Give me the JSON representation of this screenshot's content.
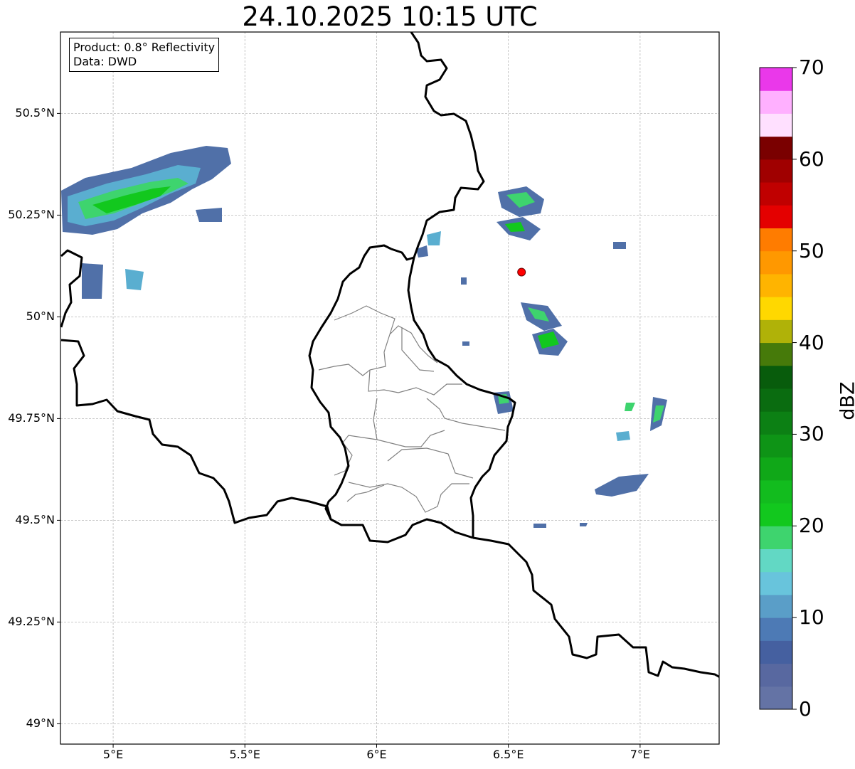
{
  "title": "24.10.2025 10:15 UTC",
  "info": {
    "product": "Product: 0.8° Reflectivity",
    "data": "Data: DWD"
  },
  "axes": {
    "lon_range": [
      4.8,
      7.3
    ],
    "lat_range": [
      48.95,
      50.7
    ],
    "x_ticks": [
      {
        "value": 5.0,
        "label": "5°E"
      },
      {
        "value": 5.5,
        "label": "5.5°E"
      },
      {
        "value": 6.0,
        "label": "6°E"
      },
      {
        "value": 6.5,
        "label": "6.5°E"
      },
      {
        "value": 7.0,
        "label": "7°E"
      }
    ],
    "y_ticks": [
      {
        "value": 50.5,
        "label": "50.5°N"
      },
      {
        "value": 50.25,
        "label": "50.25°N"
      },
      {
        "value": 50.0,
        "label": "50°N"
      },
      {
        "value": 49.75,
        "label": "49.75°N"
      },
      {
        "value": 49.5,
        "label": "49.5°N"
      },
      {
        "value": 49.25,
        "label": "49.25°N"
      },
      {
        "value": 49.0,
        "label": "49°N"
      }
    ],
    "grid": true
  },
  "radar_site": {
    "lon": 6.55,
    "lat": 50.11,
    "color": "#ff0000"
  },
  "colorbar": {
    "label": "dBZ",
    "min": 0,
    "max": 70,
    "tick_labels": [
      "0",
      "10",
      "20",
      "30",
      "40",
      "50",
      "60",
      "70"
    ],
    "colors": [
      "#6473a5",
      "#5868a0",
      "#4560a0",
      "#4d7ab5",
      "#5a9ec8",
      "#68c4dc",
      "#62d8c4",
      "#3ed46e",
      "#12c81e",
      "#12bc1e",
      "#10a818",
      "#0e9416",
      "#0c8014",
      "#0a6c10",
      "#085c0c",
      "#467a0a",
      "#b0b208",
      "#ffd800",
      "#ffb400",
      "#ff9800",
      "#ff7c00",
      "#e40000",
      "#c00000",
      "#a00000",
      "#7a0000",
      "#ffe0ff",
      "#ffb0ff",
      "#ff72ff",
      "#ea38ea"
    ]
  },
  "echo_colors": {
    "weak": "#5070a8",
    "light": "#5aaed0",
    "moderate": "#3ed46e",
    "strong": "#12c81e",
    "core": "#0a6c10"
  }
}
